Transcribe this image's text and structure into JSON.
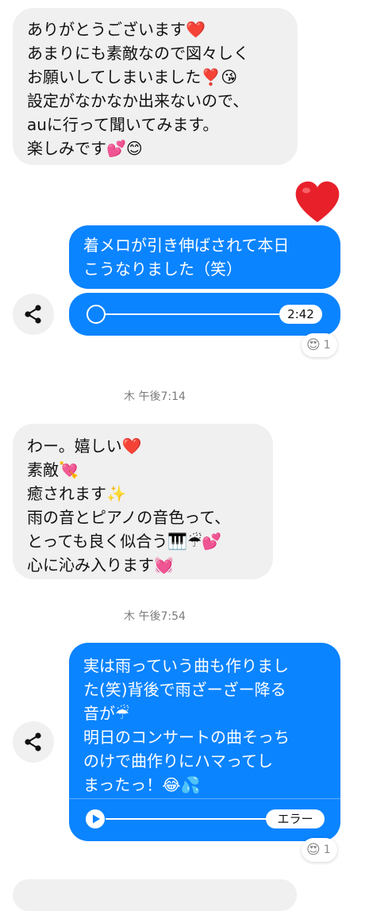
{
  "messages": {
    "m1": {
      "lines": [
        "ありがとうございます❤️",
        "あまりにも素敵なので図々しく",
        "お願いしてしまいました❣️😘",
        "設定がなかなか出来ないので、",
        "auに行って聞いてみます。",
        "楽しみです💕😊"
      ]
    },
    "big_heart": "❤️",
    "m2": {
      "lines": [
        "着メロが引き伸ばされて本日",
        "こうなりました（笑）"
      ]
    },
    "m2_audio": {
      "duration": "2:42",
      "progress": 0
    },
    "m2_reaction": {
      "emoji": "😍",
      "count": "1"
    },
    "ts1": "木 午後7:14",
    "m3": {
      "lines": [
        "わー。嬉しい❤️",
        "素敵💘",
        "癒されます✨",
        "雨の音とピアノの音色って、",
        "とっても良く似合う🎹☔💕",
        "心に沁み入ります💓"
      ]
    },
    "ts2": "木 午後7:54",
    "m4": {
      "lines": [
        "実は雨っていう曲も作りまし",
        "た(笑)背後で雨ざーざー降る",
        "音が☔",
        "明日のコンサートの曲そっち",
        "のけで曲作りにハマってし",
        "まったっ！😂💦"
      ]
    },
    "m4_audio": {
      "status": "エラー",
      "progress": 0
    },
    "m4_reaction": {
      "emoji": "😍",
      "count": "1"
    },
    "colors": {
      "outgoing_bubble": "#0b84ff",
      "incoming_bubble": "#f0f0f0",
      "heart": "#e8202a"
    }
  }
}
